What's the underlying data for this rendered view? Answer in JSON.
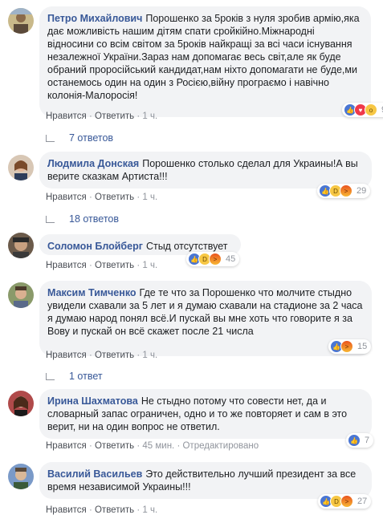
{
  "colors": {
    "author": "#385898",
    "bubble": "#f2f3f5",
    "meta": "#90949c",
    "like": "#4a76d3"
  },
  "comments": [
    {
      "author": "Петро Михайлович",
      "text": "Порошенко за 5років з нуля зробив армію,яка дає можливість нашим дітям спати сройкійно.Міжнародні відносини со всім світом за 5років найкращі за всі часи існування незалежної України.Зараз нам допомагає весь світ,але як буде обраний проросійський кандидат,нам ніхто допомагати не буде,ми останемось один на один з Росією,війну програємо і навічно колонія-Малоросія!",
      "reactions": [
        "like",
        "love",
        "wow"
      ],
      "reaction_count": "9",
      "like_label": "Нравится",
      "reply_label": "Ответить",
      "time": "1 ч.",
      "replies_label": "7 ответов"
    },
    {
      "author": "Людмила Донская",
      "text": "Порошенко столько сделал для Украины!А вы верите сказкам Артиста!!!",
      "reactions": [
        "like",
        "haha",
        "angry"
      ],
      "reaction_count": "29",
      "like_label": "Нравится",
      "reply_label": "Ответить",
      "time": "1 ч.",
      "replies_label": "18 ответов"
    },
    {
      "author": "Соломон Блойберг",
      "text": "Стыд отсутствует",
      "reactions": [
        "like",
        "haha",
        "angry"
      ],
      "reaction_count": "45",
      "like_label": "Нравится",
      "reply_label": "Ответить",
      "time": "1 ч."
    },
    {
      "author": "Максим Тимченко",
      "text": "Где те что за Порошенко что молчите стыдно увидели схавали за 5 лет и я думаю схавали на стадионе за 2 часа я думаю народ понял всё.И пускай вы мне хоть что говорите я за Вову и пускай он всё скажет после 21 числа",
      "reactions": [
        "like",
        "angry"
      ],
      "reaction_count": "15",
      "like_label": "Нравится",
      "reply_label": "Ответить",
      "time": "1 ч.",
      "replies_label": "1 ответ"
    },
    {
      "author": "Ирина Шахматова",
      "text": "Не стыдно потому что совести нет, да и словарный запас ограничен, одно и то же повторяет и сам в это верит, ни на один вопрос не ответил.",
      "reactions": [
        "like"
      ],
      "reaction_count": "7",
      "like_label": "Нравится",
      "reply_label": "Ответить",
      "time": "45 мин.",
      "edited_label": "Отредактировано"
    },
    {
      "author": "Василий Васильев",
      "text": "Это действительно лучший президент за все время независимой Украины!!!",
      "reactions": [
        "like",
        "haha",
        "angry"
      ],
      "reaction_count": "27",
      "like_label": "Нравится",
      "reply_label": "Ответить",
      "time": "1 ч."
    }
  ]
}
